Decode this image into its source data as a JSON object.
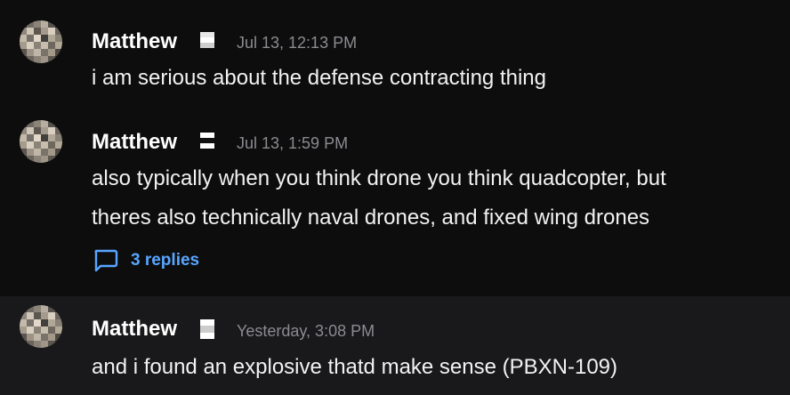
{
  "messages": [
    {
      "author": "Matthew",
      "time": "Jul 13, 12:13 PM",
      "lines": [
        "i am serious about the defense contracting thing"
      ]
    },
    {
      "author": "Matthew",
      "time": "Jul 13, 1:59 PM",
      "lines": [
        "also typically when you think drone you think quadcopter, but",
        "theres also technically naval drones, and fixed wing drones"
      ],
      "replies": "3 replies"
    },
    {
      "author": "Matthew",
      "time": "Yesterday, 3:08 PM",
      "lines": [
        "and i found an explosive thatd make sense (PBXN-109)"
      ]
    }
  ],
  "colors": {
    "background": "#0d0d0e",
    "highlight_row": "#19191b",
    "link": "#58a6ff",
    "timestamp": "#8b8b90"
  },
  "icons": [
    "pixelated-avatar",
    "flag-icon",
    "chat-bubble-icon"
  ]
}
